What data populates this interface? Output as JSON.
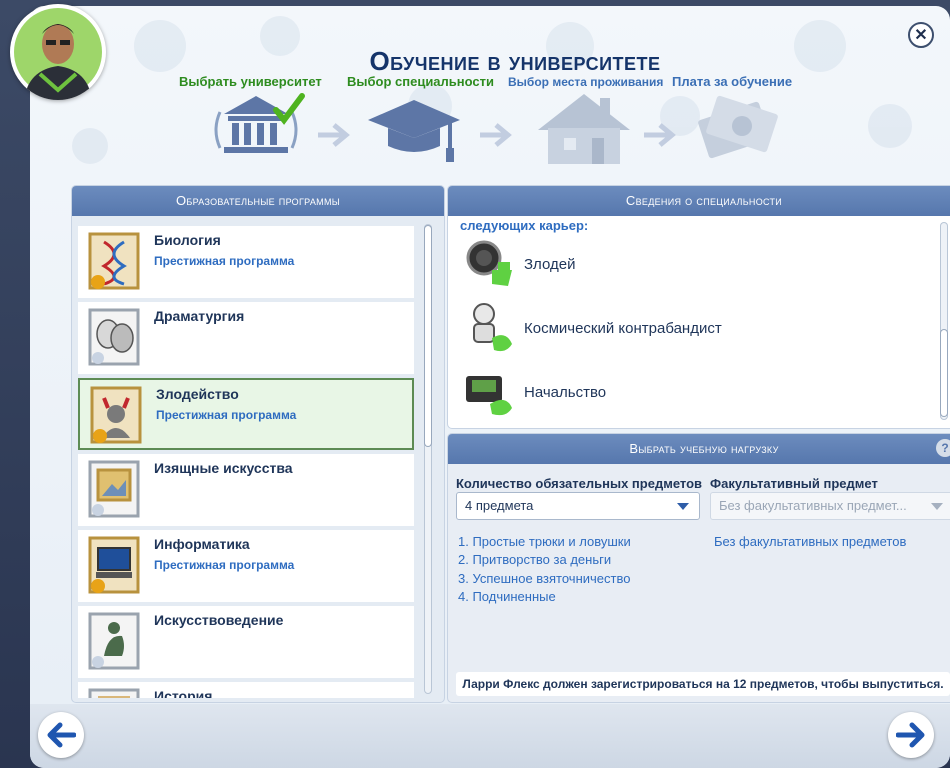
{
  "window": {
    "title": "Обучение в университете"
  },
  "steps": [
    {
      "label": "Выбрать университет",
      "state": "done",
      "icon": "university-icon"
    },
    {
      "label": "Выбор специальности",
      "state": "current",
      "icon": "graduation-cap-icon"
    },
    {
      "label": "Выбор места проживания",
      "state": "next",
      "icon": "house-icon"
    },
    {
      "label": "Плата за обучение",
      "state": "next",
      "icon": "money-icon"
    }
  ],
  "programs": {
    "header": "Образовательные программы",
    "items": [
      {
        "name": "Биология",
        "sub": "Престижная программа",
        "icon": "dna-icon"
      },
      {
        "name": "Драматургия",
        "sub": "",
        "icon": "theater-masks-icon"
      },
      {
        "name": "Злодейство",
        "sub": "Престижная программа",
        "icon": "villain-icon",
        "selected": true
      },
      {
        "name": "Изящные искусства",
        "sub": "",
        "icon": "painting-icon"
      },
      {
        "name": "Информатика",
        "sub": "Престижная программа",
        "icon": "computer-icon"
      },
      {
        "name": "Искусствоведение",
        "sub": "",
        "icon": "thinker-statue-icon"
      },
      {
        "name": "История",
        "sub": "",
        "icon": "scroll-icon"
      }
    ]
  },
  "details": {
    "header": "Сведения о специальности",
    "intro": "следующих карьер:",
    "careers": [
      {
        "name": "Злодей",
        "icon": "villain-watch-icon"
      },
      {
        "name": "Космический контрабандист",
        "icon": "astronaut-icon"
      },
      {
        "name": "Начальство",
        "icon": "briefcase-money-icon"
      }
    ]
  },
  "courseload": {
    "header": "Выбрать учебную нагрузку",
    "help": "?",
    "required_label": "Количество обязательных предметов",
    "required_value": "4 предмета",
    "elective_label": "Факультативный предмет",
    "elective_value": "Без факультативных предмет...",
    "courses": [
      "1.  Простые трюки и ловушки",
      "2.  Притворство за деньги",
      "3.  Успешное взяточничество",
      "4.  Подчиненные"
    ],
    "no_elective": "Без факультативных предметов",
    "footer": "Ларри Флекс должен зарегистрироваться на 12 предметов, чтобы выпуститься."
  },
  "colors": {
    "accent": "#5677ad",
    "done": "#2e8c1f",
    "link": "#2e6cc0"
  }
}
